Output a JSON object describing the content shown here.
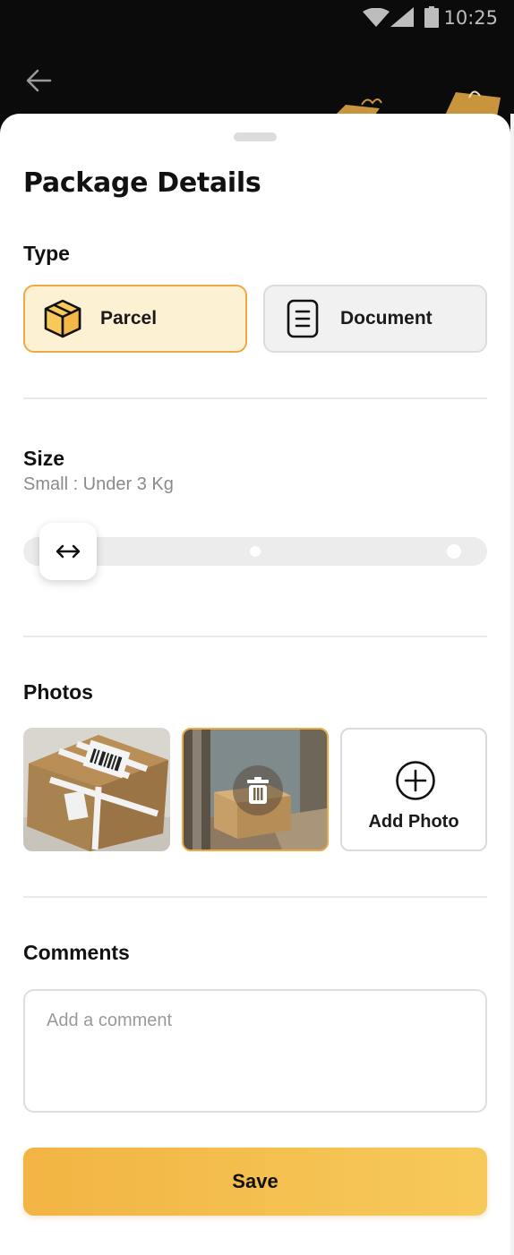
{
  "status_bar": {
    "time": "10:25"
  },
  "title": "Package Details",
  "type_section": {
    "label": "Type",
    "options": [
      {
        "label": "Parcel",
        "icon": "box-icon",
        "selected": true
      },
      {
        "label": "Document",
        "icon": "document-icon",
        "selected": false
      }
    ]
  },
  "size_section": {
    "label": "Size",
    "selected_text": "Small : Under 3 Kg",
    "slider_value": 0,
    "slider_steps": 3
  },
  "photos_section": {
    "label": "Photos",
    "photos": [
      {
        "name": "package-photo-1",
        "selected": false
      },
      {
        "name": "package-photo-2",
        "selected": true
      }
    ],
    "add_label": "Add Photo"
  },
  "comments_section": {
    "label": "Comments",
    "value": "",
    "placeholder": "Add a comment"
  },
  "save_label": "Save",
  "colors": {
    "accent": "#EEA844",
    "selected_bg": "#FDF1D4",
    "save_gradient_start": "#F2B443",
    "save_gradient_end": "#F6CA5A"
  }
}
